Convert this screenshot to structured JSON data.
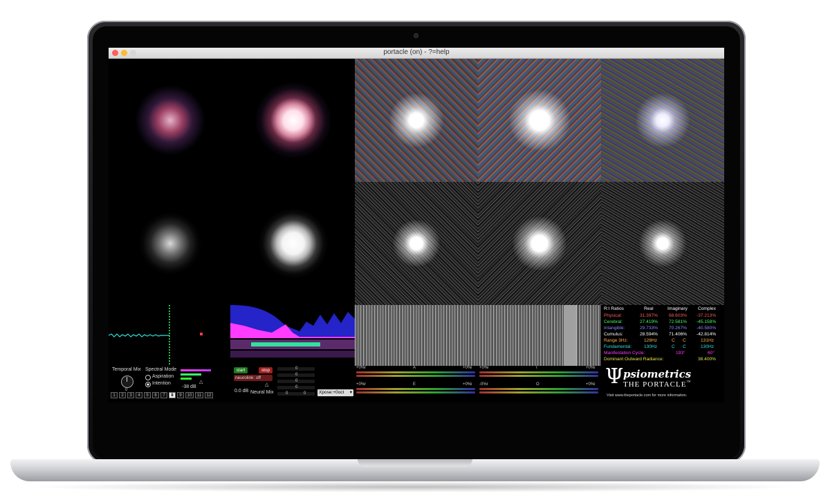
{
  "window": {
    "title": "portacle (on) - ?=help",
    "traffic_lights": [
      "#fe5f57",
      "#febb2e",
      "#d7d7d7"
    ]
  },
  "colors": {
    "accent_red": "#ff6a6a",
    "accent_green": "#3cff6a",
    "accent_magenta": "#ff3cff",
    "accent_cyan": "#33e0e0",
    "accent_orange": "#ffb04a",
    "accent_yellow": "#e0e04a"
  },
  "controls": {
    "temporal_mix_label": "Temporal Mix",
    "temporal_mix_value": "0",
    "spectral_mode_label": "Spectral Mode",
    "mode_options": [
      "Aspiration",
      "Intention"
    ],
    "mode_selected": "Intention",
    "level_db": "-38 dB",
    "presets": [
      "1",
      "2",
      "3",
      "4",
      "5",
      "6",
      "7",
      "8",
      "9",
      "10",
      "11",
      "12"
    ],
    "preset_selected": "8"
  },
  "neural": {
    "start_label": "start",
    "stop_label": "stop",
    "neurolink_label": "neurolink: off",
    "gain_label": "0.0 dB",
    "neural_mix_label": "Neural Mix",
    "xpose_value": "Xpose:+0oct",
    "values": [
      "0",
      "0",
      "0",
      "0",
      "0",
      "0"
    ]
  },
  "vowels": {
    "left_scale": "+0%r",
    "right_scale": "+0%i",
    "left_scale_neg": "-0%r",
    "labels": [
      "A",
      "I",
      "E",
      "O"
    ]
  },
  "ratios": {
    "header": [
      "R:I Ratios",
      "Real",
      "Imaginary",
      "Complex"
    ],
    "rows": [
      {
        "name": "Physical:",
        "real": "31.397%",
        "imag": "68.603%",
        "complex": "-37.213%",
        "color": "#ff5a5a"
      },
      {
        "name": "Cerebral:",
        "real": "27.419%",
        "imag": "72.581%",
        "complex": "-45.158%",
        "color": "#44ff66"
      },
      {
        "name": "Intangible:",
        "real": "29.733%",
        "imag": "70.267%",
        "complex": "-40.580%",
        "color": "#8a8aff"
      },
      {
        "name": "Cumulus:",
        "real": "28.594%",
        "imag": "71.406%",
        "complex": "-42.814%",
        "color": "#ffffff"
      }
    ],
    "range_label": "Range 3Hz:",
    "range_vals": [
      "128Hz",
      "C",
      "C",
      "131Hz"
    ],
    "fund_label": "Fundamental:",
    "fund_vals": [
      "130Hz",
      "C",
      "C",
      "130Hz"
    ],
    "cycle_label": "Manifestation Cycle:",
    "cycle_vals": [
      "193°",
      "60°"
    ],
    "radiance_label": "Dominant Outward Radiance:",
    "radiance_val": "38.400%"
  },
  "brand": {
    "logo_word": "psiometrics",
    "product": "THE PORTACLE",
    "tm": "™",
    "footer": "Visit www.theportacle.com for more information."
  }
}
